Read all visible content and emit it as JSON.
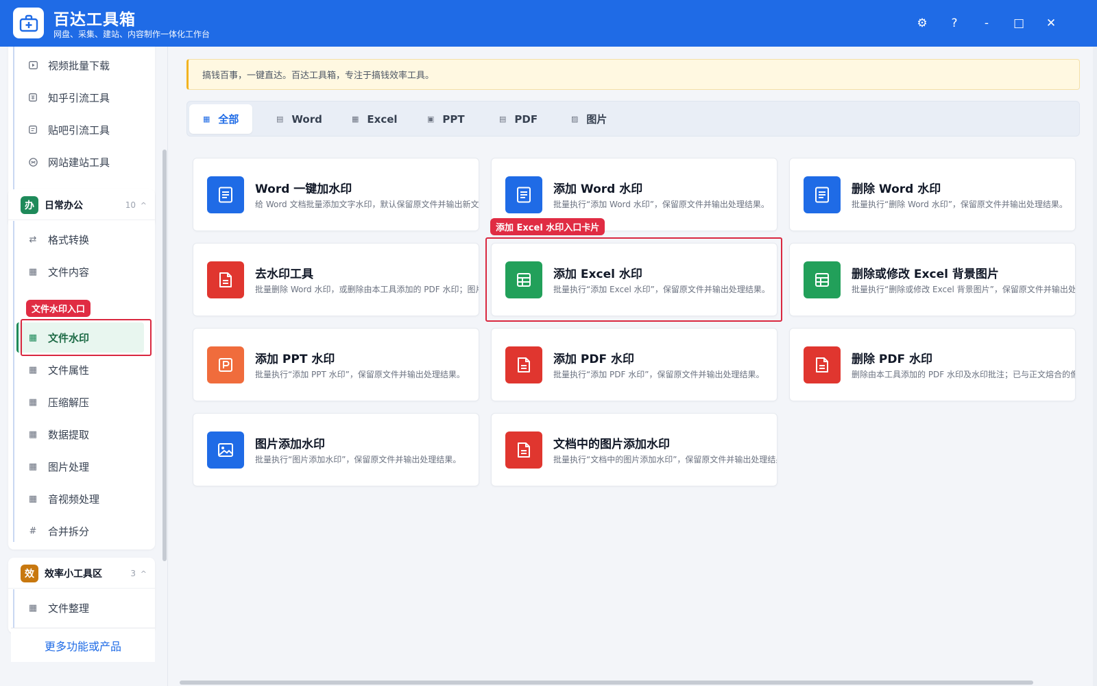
{
  "app": {
    "title": "百达工具箱",
    "subtitle": "网盘、采集、建站、内容制作一体化工作台"
  },
  "window_controls": {
    "settings": "⚙",
    "help": "?",
    "minimize": "-",
    "maximize": "□",
    "close": "✕"
  },
  "sidebar": {
    "top_items": [
      {
        "label": "视频批量下载",
        "icon": "video-icon"
      },
      {
        "label": "知乎引流工具",
        "icon": "zhihu-icon"
      },
      {
        "label": "贴吧引流工具",
        "icon": "tieba-icon"
      },
      {
        "label": "网站建站工具",
        "icon": "website-icon"
      }
    ],
    "group_daily": {
      "badge": "办",
      "title": "日常办公",
      "count": "10",
      "items": [
        {
          "label": "格式转换",
          "icon": "⇄"
        },
        {
          "label": "文件内容",
          "icon": "▦"
        },
        {
          "label": "文件水印",
          "icon": "▦"
        },
        {
          "label": "文件属性",
          "icon": "▦"
        },
        {
          "label": "压缩解压",
          "icon": "▦"
        },
        {
          "label": "数据提取",
          "icon": "▦"
        },
        {
          "label": "图片处理",
          "icon": "▦"
        },
        {
          "label": "音视频处理",
          "icon": "▦"
        },
        {
          "label": "合并拆分",
          "icon": "#"
        }
      ]
    },
    "group_efficiency": {
      "badge": "效",
      "title": "效率小工具区",
      "count": "3",
      "items": [
        {
          "label": "文件整理",
          "icon": "▦"
        }
      ]
    },
    "more_link": "更多功能或产品",
    "annotation": "文件水印入口"
  },
  "main": {
    "notice": "搞钱百事，一键直达。百达工具箱，专注于搞钱效率工具。",
    "tabs": [
      {
        "label": "全部",
        "icon": "▦"
      },
      {
        "label": "Word",
        "icon": "▤"
      },
      {
        "label": "Excel",
        "icon": "▦"
      },
      {
        "label": "PPT",
        "icon": "▣"
      },
      {
        "label": "PDF",
        "icon": "▤"
      },
      {
        "label": "图片",
        "icon": "▨"
      }
    ],
    "cards": [
      {
        "title": "Word 一键加水印",
        "desc": "给 Word 文档批量添加文字水印，默认保留原文件并输出新文件。",
        "icon": "word-doc-icon",
        "color": "#1f6be6"
      },
      {
        "title": "添加 Word 水印",
        "desc": "批量执行“添加 Word 水印”，保留原文件并输出处理结果。",
        "icon": "word-doc-icon",
        "color": "#1f6be6"
      },
      {
        "title": "删除 Word 水印",
        "desc": "批量执行“删除 Word 水印”，保留原文件并输出处理结果。",
        "icon": "word-doc-icon",
        "color": "#1f6be6"
      },
      {
        "title": "去水印工具",
        "desc": "批量删除 Word 水印，或删除由本工具添加的 PDF 水印；图片/扫描件水印暂不支持。",
        "icon": "pdf-doc-icon",
        "color": "#e0362f"
      },
      {
        "title": "添加 Excel 水印",
        "desc": "批量执行“添加 Excel 水印”，保留原文件并输出处理结果。",
        "icon": "excel-sheet-icon",
        "color": "#22a05a"
      },
      {
        "title": "删除或修改 Excel 背景图片",
        "desc": "批量执行“删除或修改 Excel 背景图片”，保留原文件并输出处理结果。",
        "icon": "excel-sheet-icon",
        "color": "#22a05a"
      },
      {
        "title": "添加 PPT 水印",
        "desc": "批量执行“添加 PPT 水印”，保留原文件并输出处理结果。",
        "icon": "ppt-icon",
        "color": "#f06c3c"
      },
      {
        "title": "添加 PDF 水印",
        "desc": "批量执行“添加 PDF 水印”，保留原文件并输出处理结果。",
        "icon": "pdf-doc-icon",
        "color": "#e0362f"
      },
      {
        "title": "删除 PDF 水印",
        "desc": "删除由本工具添加的 PDF 水印及水印批注；已与正文熔合的像素水印不支持。",
        "icon": "pdf-doc-icon",
        "color": "#e0362f"
      },
      {
        "title": "图片添加水印",
        "desc": "批量执行“图片添加水印”，保留原文件并输出处理结果。",
        "icon": "image-icon",
        "color": "#1f6be6"
      },
      {
        "title": "文档中的图片添加水印",
        "desc": "批量执行“文档中的图片添加水印”，保留原文件并输出处理结果。",
        "icon": "pdf-doc-icon",
        "color": "#e0362f"
      }
    ],
    "annotation": "添加 Excel 水印入口卡片"
  }
}
